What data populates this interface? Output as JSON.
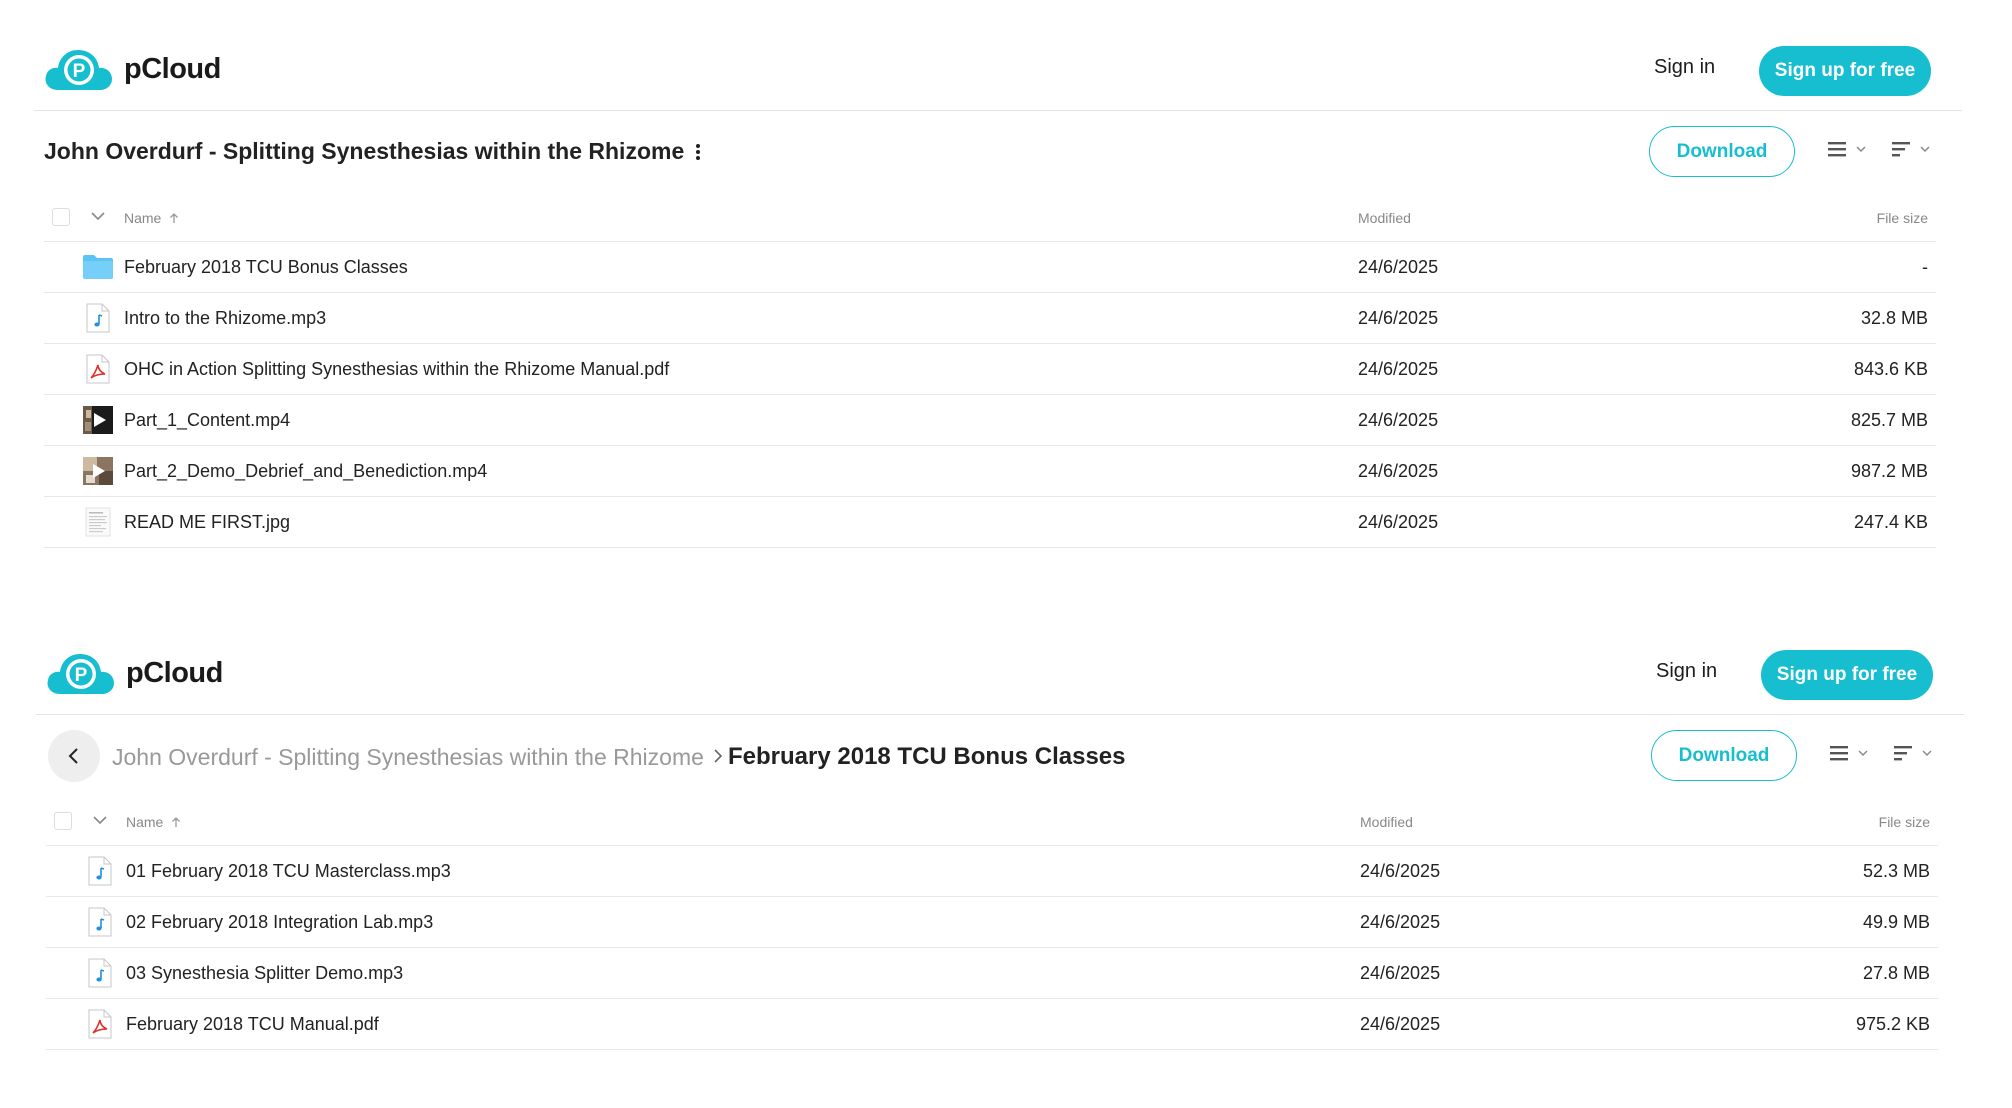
{
  "brand": {
    "name": "pCloud",
    "accent": "#17bed0"
  },
  "panels": [
    {
      "header": {
        "signin": "Sign in",
        "signup": "Sign up for free"
      },
      "title": "John Overdurf - Splitting Synesthesias within the Rhizome",
      "download": "Download",
      "columns": {
        "name": "Name",
        "modified": "Modified",
        "size": "File size"
      },
      "rows": [
        {
          "icon": "folder-icon",
          "name": "February 2018 TCU Bonus Classes",
          "modified": "24/6/2025",
          "size": "-"
        },
        {
          "icon": "audio-file-icon",
          "name": "Intro to the Rhizome.mp3",
          "modified": "24/6/2025",
          "size": "32.8 MB"
        },
        {
          "icon": "pdf-file-icon",
          "name": "OHC in Action Splitting Synesthesias within the Rhizome Manual.pdf",
          "modified": "24/6/2025",
          "size": "843.6 KB"
        },
        {
          "icon": "video-thumbnail-icon",
          "name": "Part_1_Content.mp4",
          "modified": "24/6/2025",
          "size": "825.7 MB"
        },
        {
          "icon": "video-thumbnail-icon",
          "name": "Part_2_Demo_Debrief_and_Benediction.mp4",
          "modified": "24/6/2025",
          "size": "987.2 MB"
        },
        {
          "icon": "image-thumbnail-icon",
          "name": "READ ME FIRST.jpg",
          "modified": "24/6/2025",
          "size": "247.4 KB"
        }
      ]
    },
    {
      "header": {
        "signin": "Sign in",
        "signup": "Sign up for free"
      },
      "breadcrumb": {
        "parent": "John Overdurf - Splitting Synesthesias within the Rhizome",
        "current": "February 2018 TCU Bonus Classes"
      },
      "download": "Download",
      "columns": {
        "name": "Name",
        "modified": "Modified",
        "size": "File size"
      },
      "rows": [
        {
          "icon": "audio-file-icon",
          "name": "01 February 2018 TCU Masterclass.mp3",
          "modified": "24/6/2025",
          "size": "52.3 MB"
        },
        {
          "icon": "audio-file-icon",
          "name": "02 February 2018 Integration Lab.mp3",
          "modified": "24/6/2025",
          "size": "49.9 MB"
        },
        {
          "icon": "audio-file-icon",
          "name": "03 Synesthesia Splitter Demo.mp3",
          "modified": "24/6/2025",
          "size": "27.8 MB"
        },
        {
          "icon": "pdf-file-icon",
          "name": "February 2018 TCU Manual.pdf",
          "modified": "24/6/2025",
          "size": "975.2 KB"
        }
      ]
    }
  ]
}
